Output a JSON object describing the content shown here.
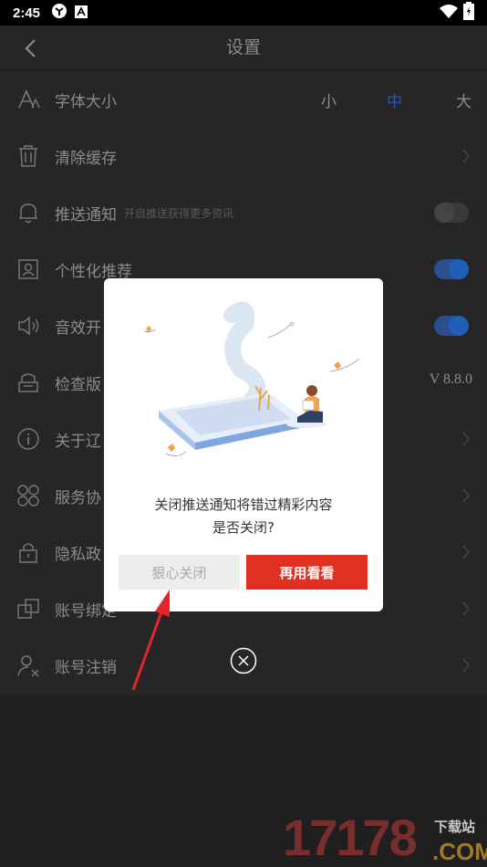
{
  "status_bar": {
    "time": "2:45"
  },
  "header": {
    "title": "设置"
  },
  "settings": {
    "font_size": {
      "label": "字体大小",
      "options": [
        "小",
        "中",
        "大"
      ],
      "selected": "中"
    },
    "clear_cache": {
      "label": "清除缓存"
    },
    "push": {
      "label": "推送通知",
      "hint": "开启推送获得更多资讯",
      "enabled": false
    },
    "personalized": {
      "label": "个性化推荐",
      "enabled": true
    },
    "sound": {
      "label": "音效开",
      "enabled": true
    },
    "check_version": {
      "label": "检查版",
      "version": "V 8.8.0"
    },
    "about": {
      "label": "关于辽"
    },
    "service": {
      "label": "服务协"
    },
    "privacy": {
      "label": "隐私政"
    },
    "account_bind": {
      "label": "账号绑定"
    },
    "account_cancel": {
      "label": "账号注销"
    }
  },
  "dialog": {
    "message_line1": "关闭推送通知将错过精彩内容",
    "message_line2": "是否关闭?",
    "close_button": "狠心关闭",
    "keep_button": "再用看看"
  },
  "watermark": {
    "number": "17178",
    "top": "下载站",
    "com": ".COM"
  },
  "colors": {
    "accent_red": "#e12f22",
    "toggle_blue": "#1f5fb8",
    "selected_blue": "#2f57a6"
  }
}
